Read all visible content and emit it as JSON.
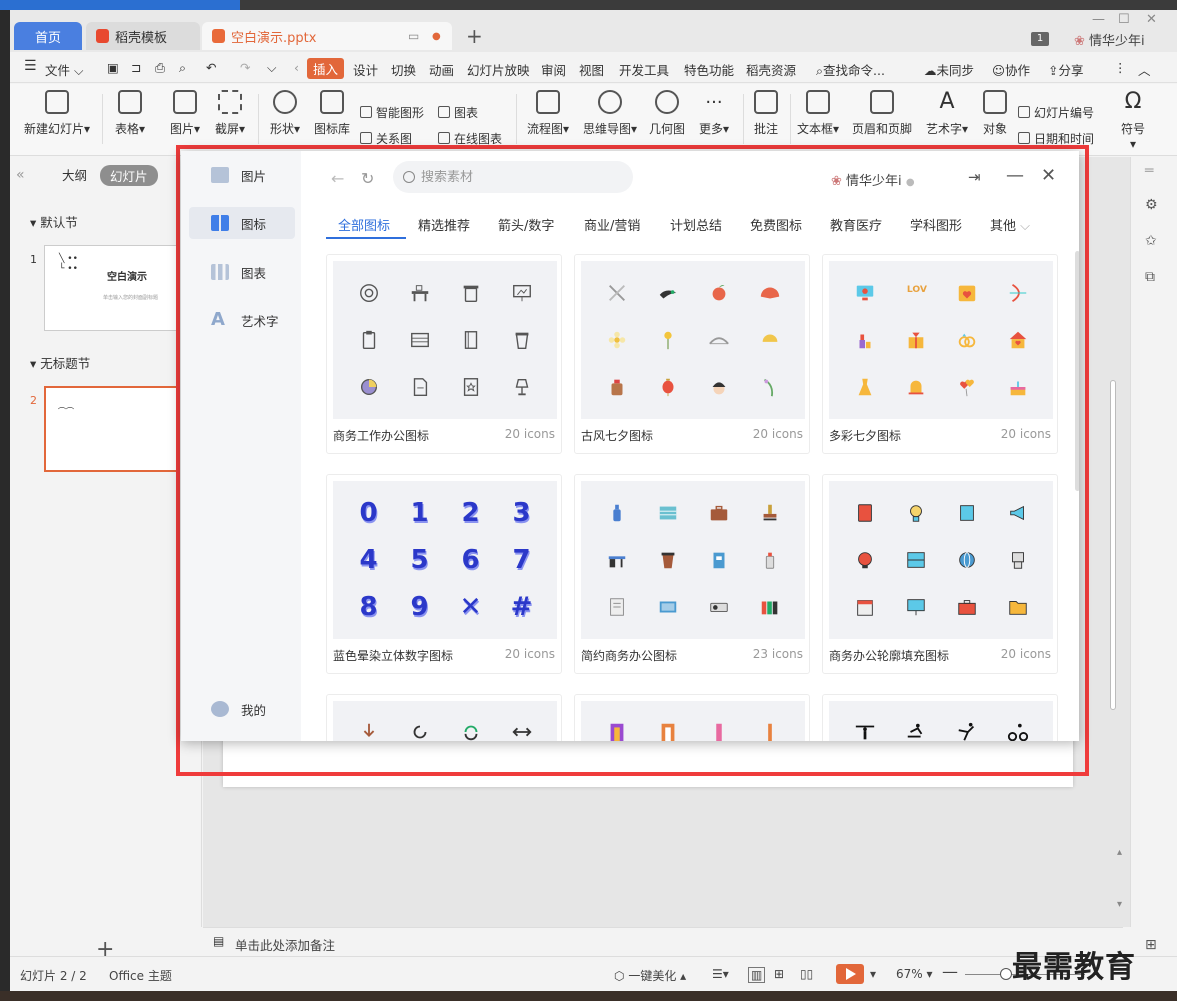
{
  "tabs": {
    "home": "首页",
    "template": "稻壳模板",
    "doc": "空白演示.pptx",
    "badge": "1",
    "user": "情华少年i"
  },
  "menu": {
    "file": "文件",
    "items": [
      "插入",
      "设计",
      "切换",
      "动画",
      "幻灯片放映",
      "审阅",
      "视图",
      "开发工具",
      "特色功能",
      "稻壳资源"
    ],
    "active": "插入",
    "search": "查找命令...",
    "sync": "未同步",
    "collab": "协作",
    "share": "分享"
  },
  "ribbon": {
    "new_slide": "新建幻灯片",
    "table": "表格",
    "picture": "图片",
    "screenshot": "截屏",
    "shape": "形状",
    "iconlib": "图标库",
    "smart": "智能图形",
    "chart": "图表",
    "relation": "关系图",
    "online_chart": "在线图表",
    "flowchart": "流程图",
    "mindmap": "思维导图",
    "geometry": "几何图",
    "more": "更多",
    "comment": "批注",
    "textbox": "文本框",
    "header_footer": "页眉和页脚",
    "wordart": "艺术字",
    "object": "对象",
    "slide_num": "幻灯片编号",
    "datetime": "日期和时间",
    "symbol": "符号"
  },
  "left_panel": {
    "outline": "大纲",
    "slides": "幻灯片",
    "section1": "默认节",
    "section2": "无标题节",
    "slide1_num": "1",
    "slide1_title": "空白演示",
    "slide1_sub": "单击输入您的封面副标题",
    "slide2_num": "2"
  },
  "notes": "单击此处添加备注",
  "status": {
    "slide": "幻灯片 2 / 2",
    "theme": "Office 主题",
    "beautify": "一键美化",
    "zoom": "67%"
  },
  "watermark": "最需教育",
  "dialog": {
    "nav": [
      {
        "label": "图片"
      },
      {
        "label": "图标"
      },
      {
        "label": "图表"
      },
      {
        "label": "艺术字"
      }
    ],
    "mine": "我的",
    "search_placeholder": "搜索素材",
    "user": "情华少年i",
    "categories": [
      "全部图标",
      "精选推荐",
      "箭头/数字",
      "商业/营销",
      "计划总结",
      "免费图标",
      "教育医疗",
      "学科图形",
      "其他"
    ],
    "cards": [
      {
        "name": "商务工作办公图标",
        "count": "20 icons"
      },
      {
        "name": "古风七夕图标",
        "count": "20 icons"
      },
      {
        "name": "多彩七夕图标",
        "count": "20 icons"
      },
      {
        "name": "蓝色晕染立体数字图标",
        "count": "20 icons",
        "digits": [
          "0",
          "1",
          "2",
          "3",
          "4",
          "5",
          "6",
          "7",
          "8",
          "9",
          "✕",
          "#"
        ]
      },
      {
        "name": "简约商务办公图标",
        "count": "23 icons"
      },
      {
        "name": "商务办公轮廓填充图标",
        "count": "20 icons"
      }
    ],
    "love_text": "LOVE"
  }
}
